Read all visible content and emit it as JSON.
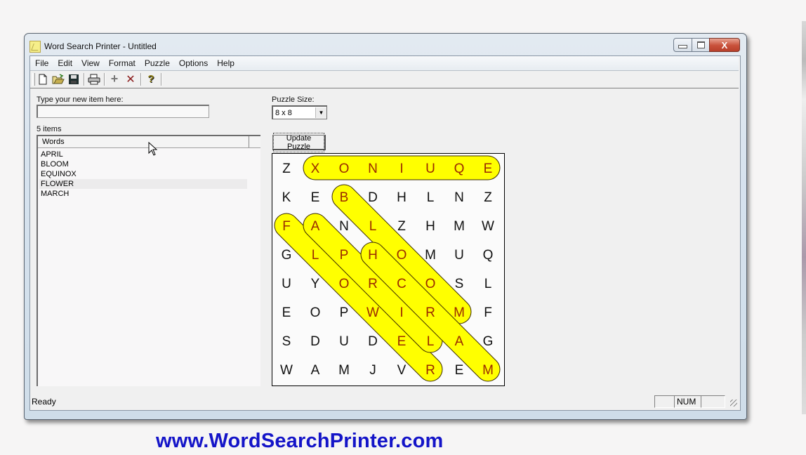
{
  "window": {
    "title": "Word Search Printer - Untitled",
    "caption_buttons": {
      "minimize": "—",
      "maximize": "□",
      "close": "X"
    }
  },
  "menu": [
    "File",
    "Edit",
    "View",
    "Format",
    "Puzzle",
    "Options",
    "Help"
  ],
  "toolbar": [
    {
      "name": "new-icon",
      "glyph": "🗋"
    },
    {
      "name": "open-icon",
      "glyph": "📂"
    },
    {
      "name": "save-icon",
      "glyph": "💾"
    },
    {
      "name": "print-icon",
      "glyph": "🖶"
    },
    {
      "name": "add-icon",
      "glyph": "+"
    },
    {
      "name": "delete-icon",
      "glyph": "✕"
    },
    {
      "name": "help-icon",
      "glyph": "?"
    }
  ],
  "left_panel": {
    "new_item_label": "Type your new item here:",
    "new_item_value": "",
    "count_label": "5 items",
    "list_header": "Words",
    "words": [
      "APRIL",
      "BLOOM",
      "EQUINOX",
      "FLOWER",
      "MARCH"
    ],
    "highlighted_index": 3
  },
  "right_panel": {
    "size_label": "Puzzle Size:",
    "size_value": "8 x 8",
    "update_button": "Update Puzzle"
  },
  "puzzle": {
    "grid": [
      [
        "Z",
        "X",
        "O",
        "N",
        "I",
        "U",
        "Q",
        "E"
      ],
      [
        "K",
        "E",
        "B",
        "D",
        "H",
        "L",
        "N",
        "Z"
      ],
      [
        "F",
        "A",
        "N",
        "L",
        "Z",
        "H",
        "M",
        "W"
      ],
      [
        "G",
        "L",
        "P",
        "H",
        "O",
        "M",
        "U",
        "Q"
      ],
      [
        "U",
        "Y",
        "O",
        "R",
        "C",
        "O",
        "S",
        "L"
      ],
      [
        "E",
        "O",
        "P",
        "W",
        "I",
        "R",
        "M",
        "F"
      ],
      [
        "S",
        "D",
        "U",
        "D",
        "E",
        "L",
        "A",
        "G"
      ],
      [
        "W",
        "A",
        "M",
        "J",
        "V",
        "R",
        "E",
        "M"
      ]
    ],
    "solutions": [
      {
        "word": "EQUINOX",
        "start": [
          0,
          7
        ],
        "end": [
          0,
          1
        ]
      },
      {
        "word": "BLOOM",
        "start": [
          1,
          2
        ],
        "end": [
          5,
          6
        ]
      },
      {
        "word": "FLOWER",
        "start": [
          2,
          0
        ],
        "end": [
          7,
          5
        ]
      },
      {
        "word": "APRIL",
        "start": [
          2,
          1
        ],
        "end": [
          6,
          5
        ]
      },
      {
        "word": "MARCH",
        "start": [
          7,
          7
        ],
        "end": [
          3,
          3
        ]
      }
    ],
    "colors": {
      "highlight": "#ffff00",
      "outline": "#3a2a00",
      "found_letter": "#9a2a00",
      "letter": "#111111"
    }
  },
  "status": {
    "text": "Ready",
    "panels": [
      "",
      "NUM",
      ""
    ]
  },
  "footer_url": "www.WordSearchPrinter.com"
}
